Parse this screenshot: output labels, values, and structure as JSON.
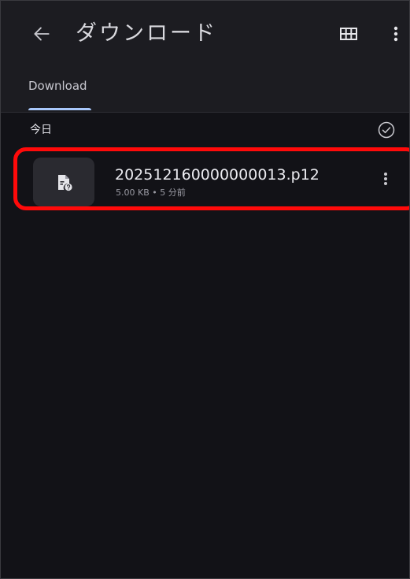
{
  "header": {
    "title": "ダウンロード",
    "back_icon": "arrow-back-icon",
    "grid_icon": "grid-view-icon",
    "more_icon": "more-vert-icon"
  },
  "tabs": [
    {
      "label": "Download",
      "selected": true
    }
  ],
  "section": {
    "title": "今日",
    "select_icon": "check-circle-icon"
  },
  "files": [
    {
      "name": "202512160000000013.p12",
      "meta": "5.00 KB • 5 分前",
      "icon": "file-unknown-icon",
      "highlighted": true
    }
  ],
  "colors": {
    "background": "#121217",
    "appbar": "#1c1c21",
    "tab_indicator": "#a8c7fa",
    "highlight": "#ff0a0a"
  }
}
